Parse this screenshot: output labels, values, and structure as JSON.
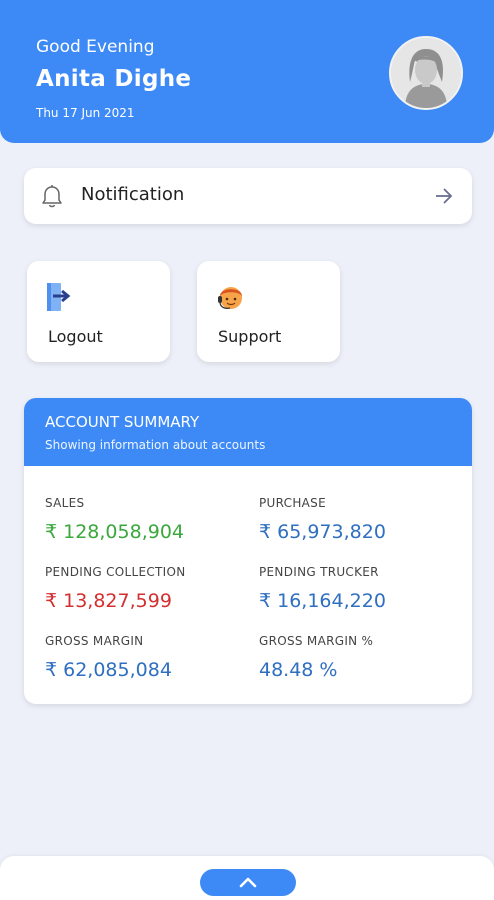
{
  "header": {
    "greeting": "Good Evening",
    "user_name": "Anita Dighe",
    "date": "Thu 17 Jun 2021",
    "avatar_icon": "user-avatar-icon"
  },
  "notification": {
    "label": "Notification",
    "icon": "bell-icon",
    "action_icon": "arrow-right-icon"
  },
  "quick_actions": [
    {
      "label": "Logout",
      "icon": "logout-icon"
    },
    {
      "label": "Support",
      "icon": "support-agent-icon"
    }
  ],
  "account_summary": {
    "title": "ACCOUNT SUMMARY",
    "subtitle": "Showing information about accounts",
    "metrics": [
      {
        "label": "SALES",
        "value": "₹ 128,058,904",
        "color": "#3aa83c"
      },
      {
        "label": "PURCHASE",
        "value": "₹ 65,973,820",
        "color": "#2f6fc0"
      },
      {
        "label": "PENDING COLLECTION",
        "value": "₹ 13,827,599",
        "color": "#d32f2f"
      },
      {
        "label": "PENDING TRUCKER",
        "value": "₹ 16,164,220",
        "color": "#2f6fc0"
      },
      {
        "label": "GROSS MARGIN",
        "value": "₹ 62,085,084",
        "color": "#2f6fc0"
      },
      {
        "label": "GROSS MARGIN %",
        "value": "48.48 %",
        "color": "#2f6fc0"
      }
    ]
  },
  "bottom": {
    "expand_icon": "chevron-up-icon"
  },
  "colors": {
    "accent": "#3d8af7",
    "background": "#edf0f8"
  }
}
